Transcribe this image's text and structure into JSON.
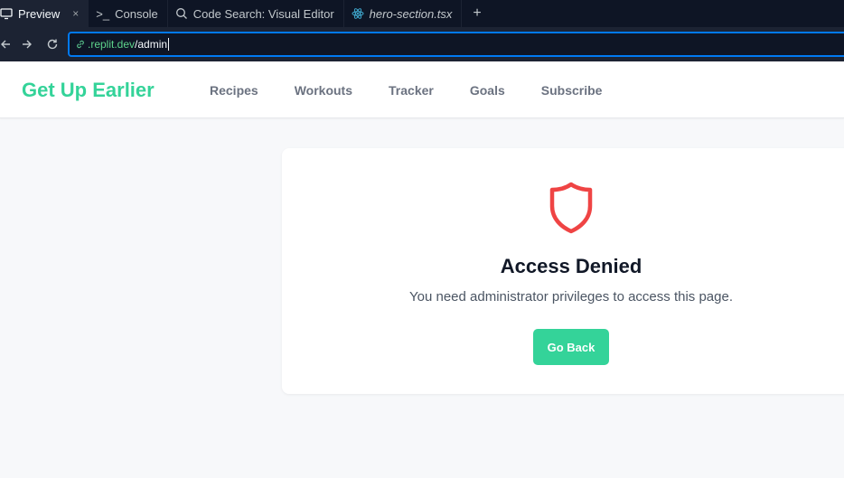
{
  "ide": {
    "tabs": [
      {
        "label": "Preview",
        "icon": "monitor-icon",
        "closable": true
      },
      {
        "label": "Console",
        "icon": "terminal-icon"
      },
      {
        "label": "Code Search: Visual Editor",
        "icon": "search-icon"
      },
      {
        "label": "hero-section.tsx",
        "icon": "react-icon"
      }
    ],
    "add_tab": "+",
    "close_glyph": "×",
    "terminal_glyph": ">_"
  },
  "url": {
    "host": ".replit.dev",
    "path": "/admin"
  },
  "site": {
    "brand": "Get Up Earlier",
    "nav": [
      "Recipes",
      "Workouts",
      "Tracker",
      "Goals",
      "Subscribe"
    ]
  },
  "access": {
    "title": "Access Denied",
    "message": "You need administrator privileges to access this page.",
    "button": "Go Back"
  },
  "colors": {
    "brand": "#34d399",
    "shield": "#ef4444",
    "ide_bg": "#0e1525",
    "url_focus": "#0079f2"
  }
}
